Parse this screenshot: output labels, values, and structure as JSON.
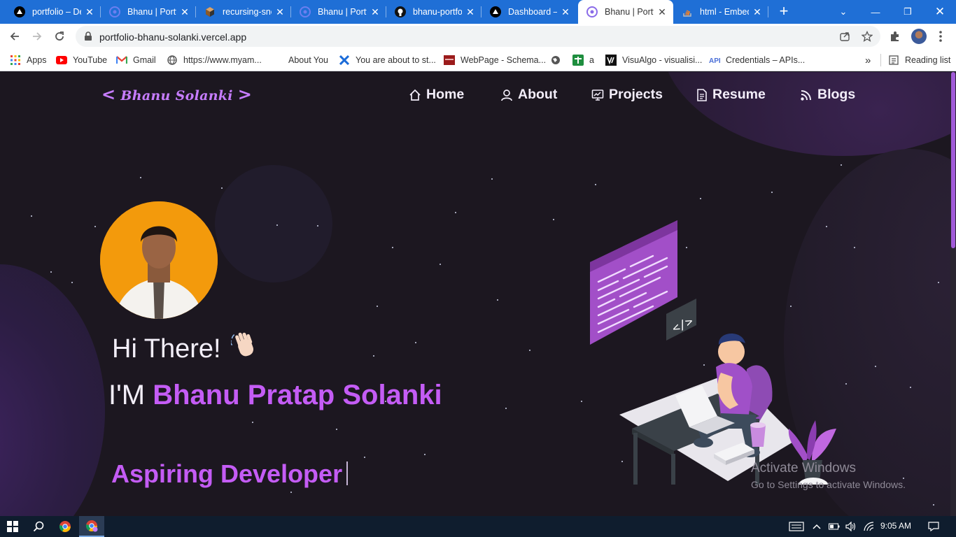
{
  "browser": {
    "tabs": [
      {
        "title": "portfolio – Deployment Overview",
        "icon": "vercel-triangle-icon",
        "active": false
      },
      {
        "title": "Bhanu | Portfolio",
        "icon": "portfolio-logo-icon",
        "active": false
      },
      {
        "title": "recursing-snoyd",
        "icon": "netlify-cube-icon",
        "active": false
      },
      {
        "title": "Bhanu | Portfolio",
        "icon": "portfolio-logo-icon",
        "active": false
      },
      {
        "title": "bhanu-portfolio",
        "icon": "github-icon",
        "active": false
      },
      {
        "title": "Dashboard – Vercel",
        "icon": "vercel-triangle-icon",
        "active": false
      },
      {
        "title": "Bhanu | Portfolio",
        "icon": "portfolio-logo-icon",
        "active": true
      },
      {
        "title": "html - Embed",
        "icon": "stackoverflow-icon",
        "active": false
      }
    ],
    "url": "portfolio-bhanu-solanki.vercel.app",
    "bookmarks": [
      {
        "label": "Apps",
        "icon": "apps-grid-icon"
      },
      {
        "label": "YouTube",
        "icon": "youtube-icon"
      },
      {
        "label": "Gmail",
        "icon": "gmail-icon"
      },
      {
        "label": "https://www.myam...",
        "icon": "globe-icon"
      },
      {
        "label": "About You",
        "icon": "blank-icon"
      },
      {
        "label": "You are about to st...",
        "icon": "x-logo-icon"
      },
      {
        "label": "WebPage - Schema...",
        "icon": "schema-icon"
      },
      {
        "label": "",
        "icon": "globe-icon"
      },
      {
        "label": "a",
        "icon": "plus-green-icon"
      },
      {
        "label": "VisuAlgo - visualisi...",
        "icon": "visualgo-icon"
      },
      {
        "label": "Credentials – APIs...",
        "icon": "api-icon"
      }
    ],
    "bookmarks_more": "»",
    "reading_list": "Reading list"
  },
  "site": {
    "logo_left": "<",
    "logo_text": "Bhanu Solanki",
    "logo_right": ">",
    "nav": [
      {
        "label": "Home",
        "icon": "home-icon"
      },
      {
        "label": "About",
        "icon": "user-icon"
      },
      {
        "label": "Projects",
        "icon": "projects-chart-icon"
      },
      {
        "label": "Resume",
        "icon": "document-icon"
      },
      {
        "label": "Blogs",
        "icon": "blog-feed-icon"
      }
    ],
    "greeting": "Hi There!",
    "greeting_emoji": "waving-hand-icon",
    "intro_prefix": "I'M",
    "name": "Bhanu Pratap Solanki",
    "typed_text": "Aspiring Developer",
    "accent_color": "#c45cf5"
  },
  "watermark": {
    "line1": "Activate Windows",
    "line2": "Go to Settings to activate Windows."
  },
  "taskbar": {
    "time": "9:05 AM"
  }
}
